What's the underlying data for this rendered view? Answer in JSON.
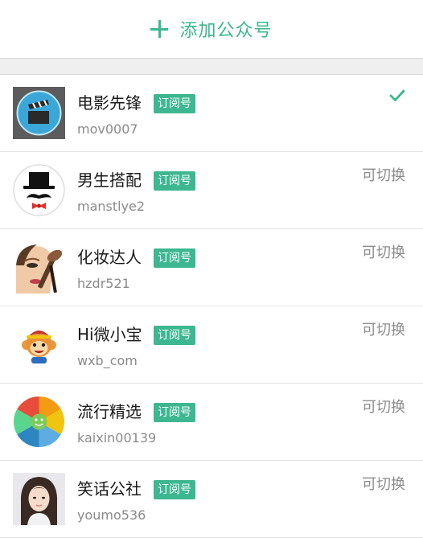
{
  "header": {
    "add_label": "添加公众号"
  },
  "accounts": [
    {
      "name": "电影先锋",
      "badge": "订阅号",
      "id": "mov0007",
      "status": "",
      "avatar_icon": "film-clapper-icon",
      "selected": true
    },
    {
      "name": "男生搭配",
      "badge": "订阅号",
      "id": "manstlye2",
      "status": "可切换",
      "avatar_icon": "top-hat-mustache-icon",
      "selected": false
    },
    {
      "name": "化妆达人",
      "badge": "订阅号",
      "id": "hzdr521",
      "status": "可切换",
      "avatar_icon": "makeup-face-icon",
      "selected": false
    },
    {
      "name": "Hi微小宝",
      "badge": "订阅号",
      "id": "wxb_com",
      "status": "可切换",
      "avatar_icon": "cartoon-monkey-icon",
      "selected": false
    },
    {
      "name": "流行精选",
      "badge": "订阅号",
      "id": "kaixin00139",
      "status": "可切换",
      "avatar_icon": "rainbow-aperture-icon",
      "selected": false
    },
    {
      "name": "笑话公社",
      "badge": "订阅号",
      "id": "youmo536",
      "status": "可切换",
      "avatar_icon": "girl-portrait-icon",
      "selected": false
    }
  ],
  "colors": {
    "accent": "#3cb78f",
    "background": "#efefef",
    "muted_text": "#8a8a8a"
  }
}
